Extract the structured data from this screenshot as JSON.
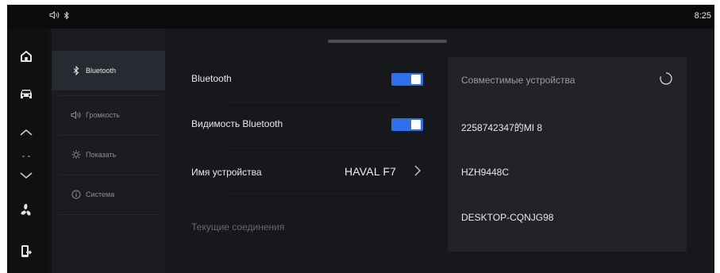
{
  "status_bar": {
    "volume_icon": "speaker-icon",
    "bluetooth_icon": "bluetooth-icon",
    "time": "8:25"
  },
  "rail": {
    "icons": [
      "home-icon",
      "car-icon",
      "chevron-up-icon",
      "dashes",
      "chevron-down-icon",
      "fan-icon",
      "phone-exit-icon"
    ],
    "dashes": "- -"
  },
  "menu": {
    "items": [
      {
        "label": "Bluetooth",
        "icon": "bluetooth-icon",
        "active": true
      },
      {
        "label": "Громкость",
        "icon": "speaker-icon",
        "active": false
      },
      {
        "label": "Показать",
        "icon": "sun-icon",
        "active": false
      },
      {
        "label": "Система",
        "icon": "info-icon",
        "active": false
      }
    ]
  },
  "settings": {
    "bluetooth_label": "Bluetooth",
    "bluetooth_on": true,
    "visibility_label": "Видимость Bluetooth",
    "visibility_on": true,
    "device_name_label": "Имя устройства",
    "device_name_value": "HAVAL F7",
    "current_connections_label": "Текущие соединения"
  },
  "devices_panel": {
    "title": "Совместимые устройства",
    "devices": [
      "2258742347的MI 8",
      "HZH9448C",
      "DESKTOP-CQNJG98"
    ]
  },
  "colors": {
    "accent": "#2f6fe9",
    "background": "#17181b",
    "panel": "#222328"
  }
}
